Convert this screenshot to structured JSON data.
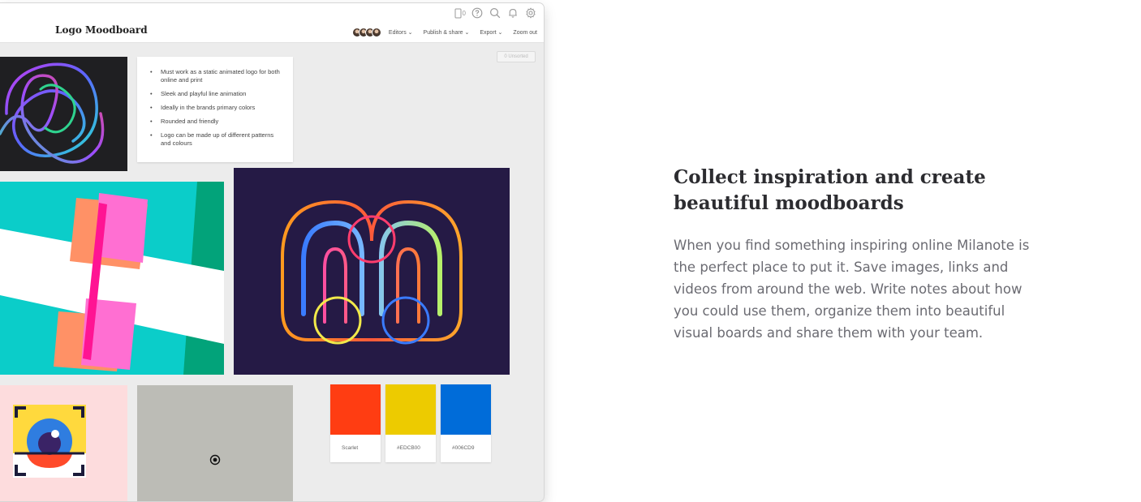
{
  "app": {
    "board_title": "Logo Moodboard",
    "device_count": "0",
    "menu": {
      "editors": "Editors ⌄",
      "publish": "Publish & share ⌄",
      "export": "Export ⌄",
      "zoom": "Zoom out"
    },
    "unsorted": "0 Unsorted",
    "note_items": [
      "Must work as a static animated logo for both online and print",
      "Sleek and playful line animation",
      "Ideally in the brands primary colors",
      "Rounded and friendly",
      "Logo can be made up of different patterns and colours"
    ],
    "swatches": [
      {
        "label": "Scarlet",
        "color": "#FF3D12"
      },
      {
        "label": "#EDCB00",
        "color": "#EDCB00"
      },
      {
        "label": "#006CD9",
        "color": "#006CD9"
      }
    ]
  },
  "marketing": {
    "headline": "Collect inspiration and create beautiful moodboards",
    "body": "When you find something inspiring online Milanote is the perfect place to put it. Save images, links and videos from around the web. Write notes about how you could use them, organize them into beautiful visual boards and share them with your team."
  },
  "colors": {
    "swirl_bg": "#1f1f22",
    "geo_bg": "#0bcdc9",
    "m_bg": "#251a45",
    "eye_bg": "#fddcdd",
    "gray_bg": "#bcbcb6"
  }
}
